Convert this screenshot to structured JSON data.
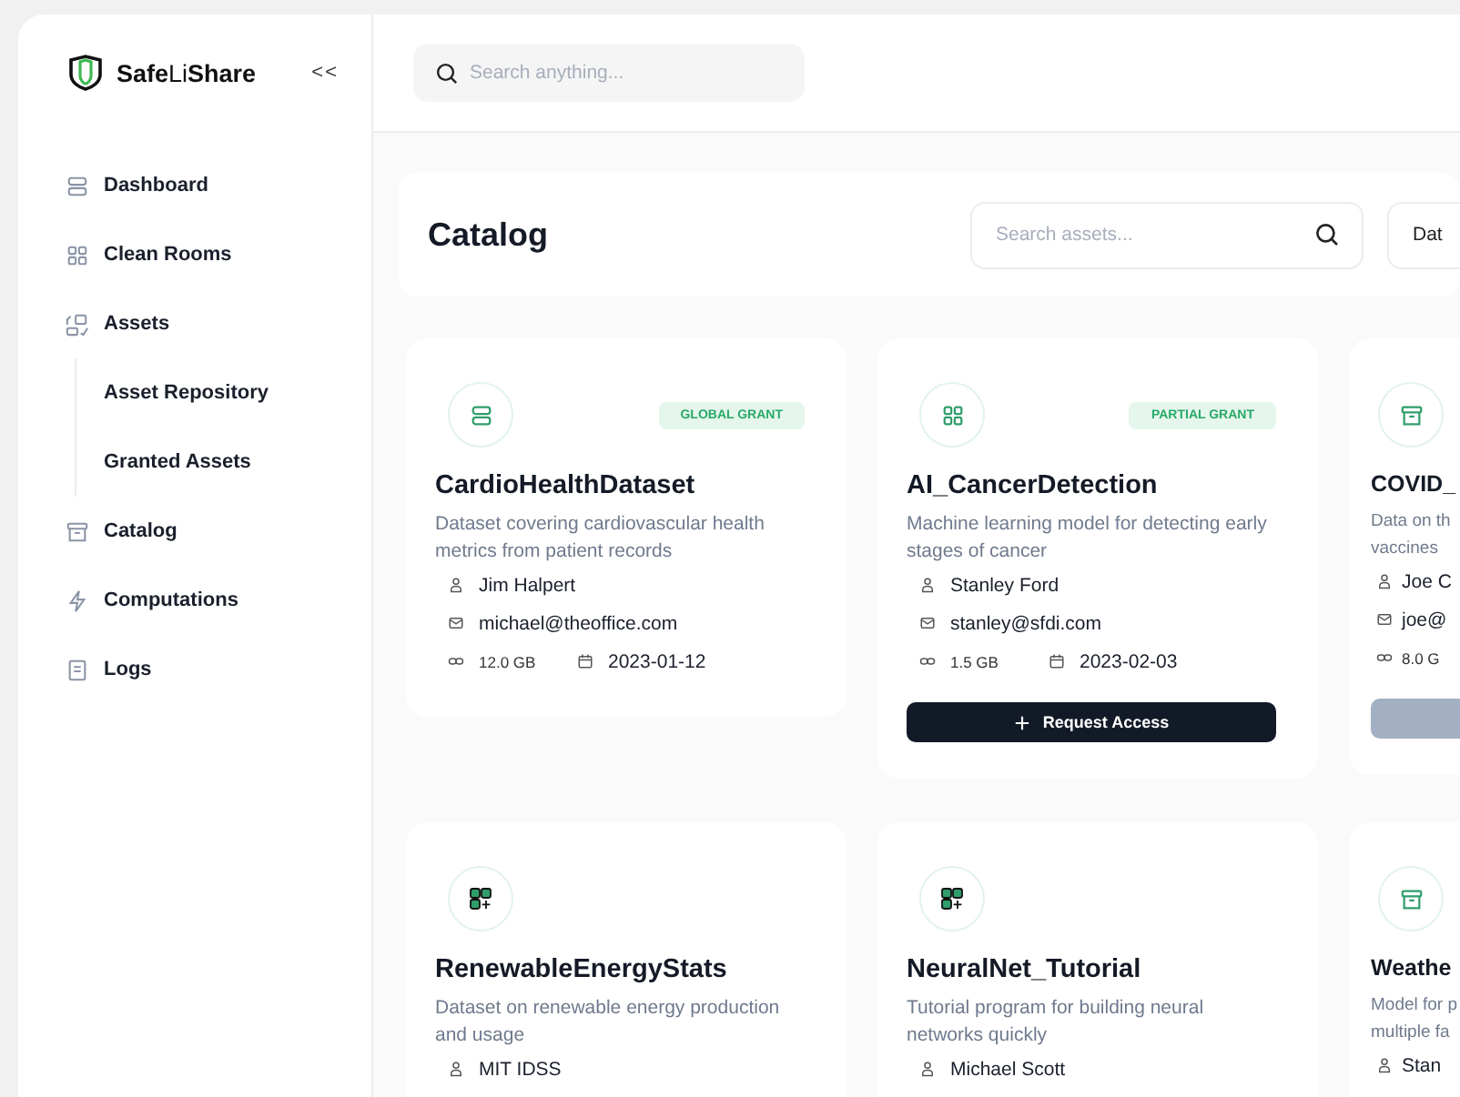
{
  "brand": {
    "name_bold": "Safe",
    "name_light": "Li",
    "name_end": "Share",
    "collapse": "<<"
  },
  "search": {
    "placeholder": "Search anything..."
  },
  "sidebar": {
    "items": [
      {
        "label": "Dashboard",
        "kind": "stack"
      },
      {
        "label": "Clean Rooms",
        "kind": "grid"
      },
      {
        "label": "Assets",
        "kind": "assets",
        "children": [
          {
            "label": "Asset Repository"
          },
          {
            "label": "Granted Assets"
          }
        ]
      },
      {
        "label": "Catalog",
        "kind": "archive"
      },
      {
        "label": "Computations",
        "kind": "bolt"
      },
      {
        "label": "Logs",
        "kind": "log"
      }
    ]
  },
  "header": {
    "title": "Catalog",
    "search_placeholder": "Search assets...",
    "filter": "Dat"
  },
  "cards": [
    {
      "kind": "stack",
      "grant": "GLOBAL GRANT",
      "title": "CardioHealthDataset",
      "description": "Dataset covering cardiovascular health metrics from patient records",
      "owner": "Jim Halpert",
      "email": "michael@theoffice.com",
      "size": "12.0 GB",
      "date": "2023-01-12",
      "button": {
        "kind": "none"
      }
    },
    {
      "kind": "grid",
      "grant": "PARTIAL GRANT",
      "title": "AI_CancerDetection",
      "description": "Machine learning model for detecting early stages of cancer",
      "owner": "Stanley Ford",
      "email": "stanley@sfdi.com",
      "size": "1.5 GB",
      "date": "2023-02-03",
      "button": {
        "kind": "request",
        "label": "Request Access"
      }
    },
    {
      "kind": "archive",
      "title": "COVID_",
      "description": "Data on th\nvaccines",
      "owner": "Joe C",
      "email": "joe@",
      "size": "8.0 G",
      "button": {
        "kind": "disabled"
      }
    },
    {
      "kind": "apps",
      "title": "RenewableEnergyStats",
      "description": "Dataset on renewable energy production and usage",
      "owner": "MIT IDSS",
      "button": {
        "kind": "none"
      }
    },
    {
      "kind": "apps",
      "title": "NeuralNet_Tutorial",
      "description": "Tutorial program for building neural networks quickly",
      "owner": "Michael Scott",
      "button": {
        "kind": "none"
      }
    },
    {
      "kind": "archive",
      "title": "Weathe",
      "description": "Model for p\nmultiple fa",
      "owner": "Stan",
      "button": {
        "kind": "none"
      }
    }
  ]
}
